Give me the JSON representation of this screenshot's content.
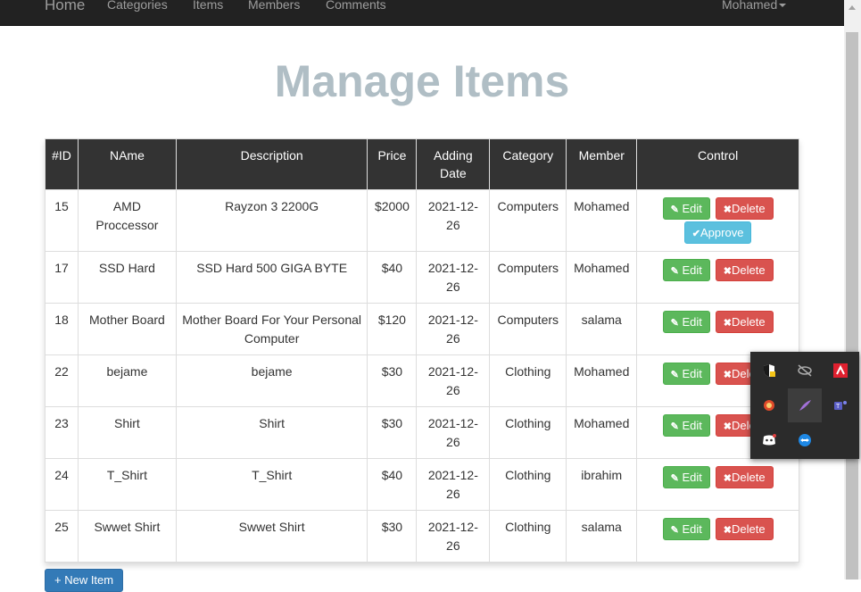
{
  "navbar": {
    "home": "Home",
    "links": [
      "Categories",
      "Items",
      "Members",
      "Comments"
    ],
    "user": "Mohamed"
  },
  "page": {
    "title": "Manage Items"
  },
  "table": {
    "headers": [
      "#ID",
      "NAme",
      "Description",
      "Price",
      "Adding Date",
      "Category",
      "Member",
      "Control"
    ],
    "rows": [
      {
        "id": "15",
        "name": "AMD Proccessor",
        "description": "Rayzon 3 2200G",
        "price": "$2000",
        "date": "2021-12-26",
        "category": "Computers",
        "member": "Mohamed",
        "approve": true
      },
      {
        "id": "17",
        "name": "SSD Hard",
        "description": "SSD Hard 500 GIGA BYTE",
        "price": "$40",
        "date": "2021-12-26",
        "category": "Computers",
        "member": "Mohamed",
        "approve": false
      },
      {
        "id": "18",
        "name": "Mother Board",
        "description": "Mother Board For Your Personal Computer",
        "price": "$120",
        "date": "2021-12-26",
        "category": "Computers",
        "member": "salama",
        "approve": false
      },
      {
        "id": "22",
        "name": "bejame",
        "description": "bejame",
        "price": "$30",
        "date": "2021-12-26",
        "category": "Clothing",
        "member": "Mohamed",
        "approve": false
      },
      {
        "id": "23",
        "name": "Shirt",
        "description": "Shirt",
        "price": "$30",
        "date": "2021-12-26",
        "category": "Clothing",
        "member": "Mohamed",
        "approve": false
      },
      {
        "id": "24",
        "name": "T_Shirt",
        "description": "T_Shirt",
        "price": "$40",
        "date": "2021-12-26",
        "category": "Clothing",
        "member": "ibrahim",
        "approve": false
      },
      {
        "id": "25",
        "name": "Swwet Shirt",
        "description": "Swwet Shirt",
        "price": "$30",
        "date": "2021-12-26",
        "category": "Clothing",
        "member": "salama",
        "approve": false
      }
    ],
    "buttons": {
      "edit": "Edit",
      "delete": "Delete",
      "approve": "Approve"
    }
  },
  "actions": {
    "new_item": "+ New Item"
  },
  "tray": {
    "icons": [
      "shield-warning-icon",
      "hidden-icon",
      "amd-icon",
      "security-app-icon",
      "feather-icon",
      "teams-icon",
      "discord-icon",
      "teamviewer-icon"
    ]
  },
  "colors": {
    "title": "#b0bec5",
    "edit": "#5cb85c",
    "delete": "#d9534f",
    "approve": "#5bc0de",
    "primary": "#337ab7"
  }
}
